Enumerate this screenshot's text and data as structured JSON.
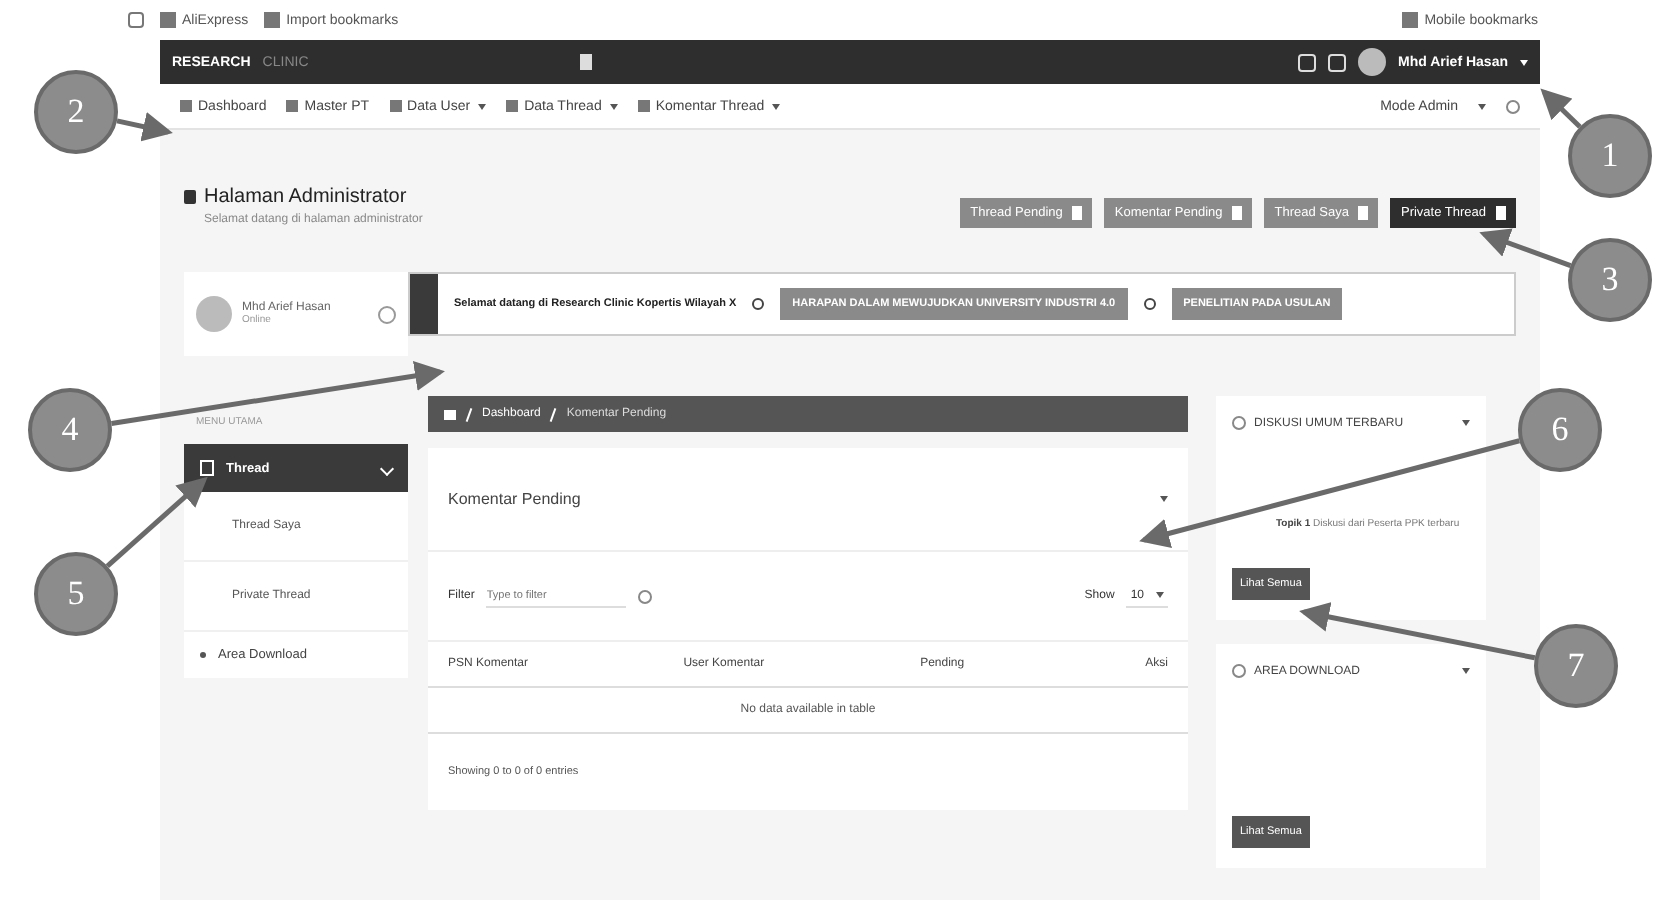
{
  "bookmarks_bar": {
    "items": [
      "AliExpress",
      "Import bookmarks"
    ],
    "right": "Mobile bookmarks"
  },
  "header": {
    "brand": "RESEARCH",
    "brand_sub": "CLINIC",
    "user": "Mhd Arief Hasan"
  },
  "nav": {
    "items": [
      {
        "label": "Dashboard",
        "dropdown": false
      },
      {
        "label": "Master PT",
        "dropdown": false
      },
      {
        "label": "Data User",
        "dropdown": true
      },
      {
        "label": "Data Thread",
        "dropdown": true
      },
      {
        "label": "Komentar Thread",
        "dropdown": true
      }
    ],
    "right": "Mode Admin"
  },
  "page": {
    "title": "Halaman Administrator",
    "subtitle": "Selamat datang di halaman administrator"
  },
  "action_buttons": [
    {
      "label": "Thread Pending",
      "selected": false
    },
    {
      "label": "Komentar Pending",
      "selected": false
    },
    {
      "label": "Thread Saya",
      "selected": false
    },
    {
      "label": "Private Thread",
      "selected": true
    }
  ],
  "profile": {
    "name": "Mhd Arief Hasan",
    "status": "Online"
  },
  "announcements": [
    {
      "text": "Selamat datang di Research Clinic Kopertis Wilayah X",
      "kind": "plain"
    },
    {
      "text": "HARAPAN DALAM MEWUJUDKAN UNIVERSITY INDUSTRI 4.0",
      "kind": "tag"
    },
    {
      "text": "PENELITIAN PADA USULAN",
      "kind": "tag"
    }
  ],
  "sidebar": {
    "heading": "MENU UTAMA",
    "items": [
      {
        "label": "Thread",
        "selected": true,
        "children": [
          {
            "label": "Thread Saya",
            "selected": false
          },
          {
            "label": "Private Thread",
            "selected": false
          }
        ]
      },
      {
        "label": "Area Download",
        "selected": false
      }
    ]
  },
  "breadcrumb": [
    "Dashboard",
    "Komentar Pending"
  ],
  "panel": {
    "title": "Komentar Pending",
    "filter_label": "Filter",
    "filter_placeholder": "Type to filter",
    "show_label": "Show",
    "show_value": "10",
    "columns": [
      "PSN Komentar",
      "User Komentar",
      "Pending",
      "Aksi"
    ],
    "empty": "No data available in table",
    "info": "Showing 0 to 0 of 0 entries"
  },
  "widgets": [
    {
      "title": "DISKUSI UMUM TERBARU",
      "kind": "discussion",
      "item_title": "Topik 1",
      "item_text": "Diskusi dari Peserta PPK terbaru",
      "button": "Lihat Semua"
    },
    {
      "title": "AREA DOWNLOAD",
      "kind": "download",
      "button": "Lihat Semua"
    }
  ],
  "annotations": [
    "1",
    "2",
    "3",
    "4",
    "5",
    "6",
    "7"
  ]
}
